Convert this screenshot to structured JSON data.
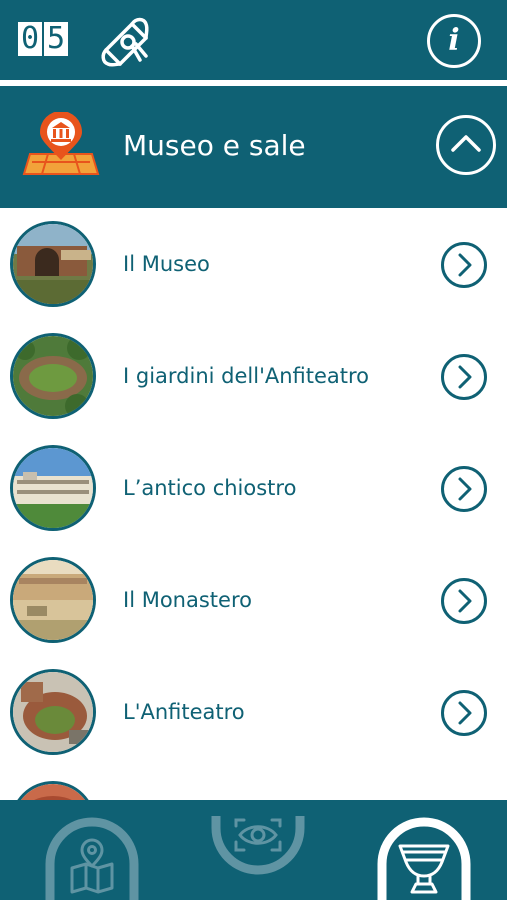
{
  "header": {
    "counter_digits": [
      "0",
      "5"
    ],
    "scroll_icon": "diploma-scroll-icon",
    "info_label": "i"
  },
  "section": {
    "title": "Museo e sale",
    "icon": "museum-map-pin-icon",
    "toggle_icon": "chevron-up-icon"
  },
  "list": {
    "items": [
      {
        "label": "Il Museo",
        "thumb": "museum-ruins-photo"
      },
      {
        "label": "I giardini dell'Anfiteatro",
        "thumb": "amphitheatre-gardens-photo"
      },
      {
        "label": "L’antico chiostro",
        "thumb": "cloister-photo"
      },
      {
        "label": "Il Monastero",
        "thumb": "monastery-painting"
      },
      {
        "label": "L'Anfiteatro",
        "thumb": "amphitheatre-photo"
      },
      {
        "label": "",
        "thumb": "partial-photo"
      }
    ]
  },
  "bottom_nav": {
    "items": [
      {
        "icon": "map-location-icon",
        "active": false
      },
      {
        "icon": "eye-scan-icon",
        "active": false
      },
      {
        "icon": "vase-icon",
        "active": true
      }
    ]
  },
  "colors": {
    "primary": "#0f6174",
    "accent_orange": "#e8541c",
    "white": "#ffffff"
  }
}
